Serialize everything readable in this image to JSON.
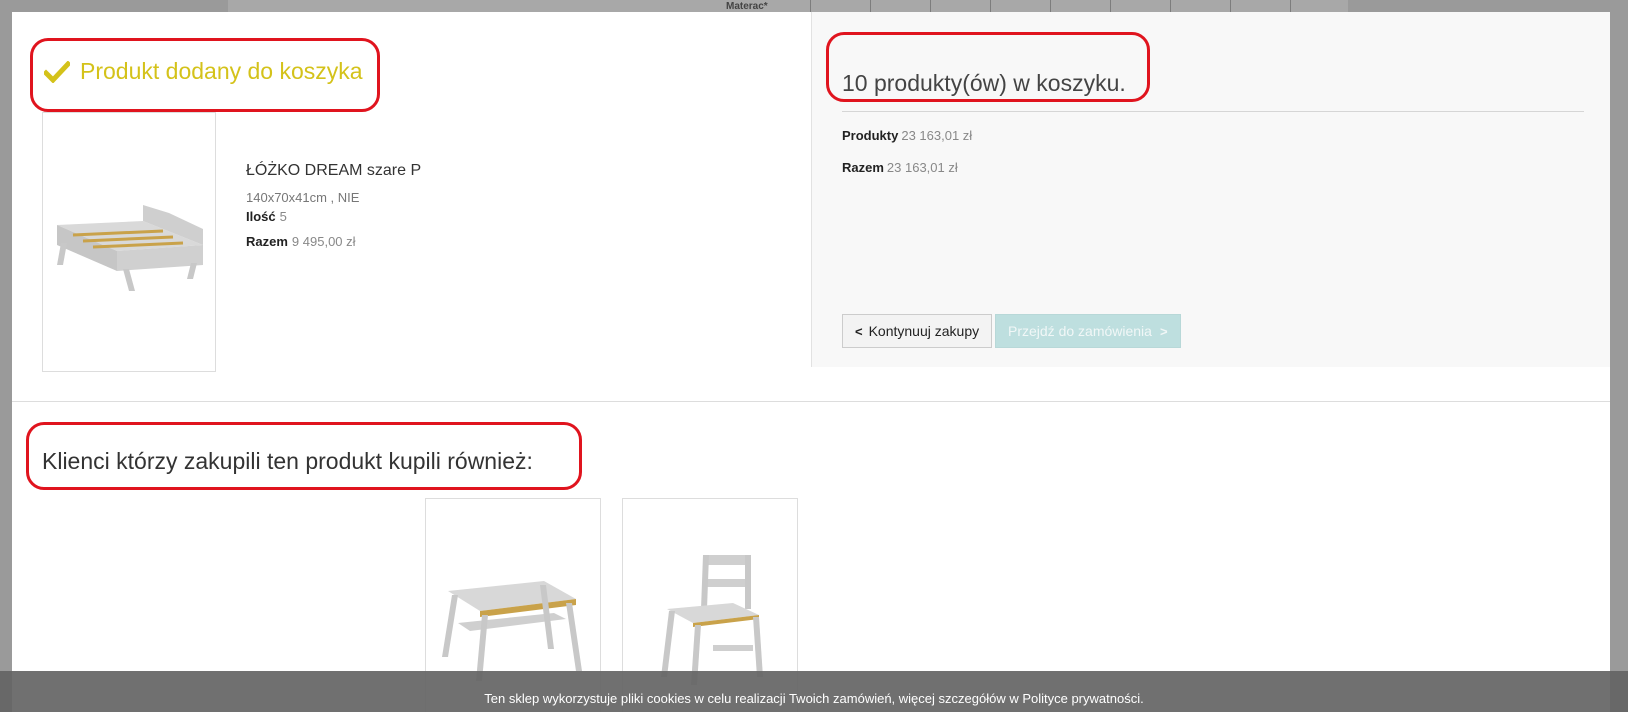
{
  "background": {
    "label": "Materac*"
  },
  "modal": {
    "close_icon": "close-circle-icon",
    "added": {
      "title": "Produkt dodany do koszyka",
      "icon": "check-icon"
    },
    "product": {
      "name": "ŁÓŻKO DREAM szare P",
      "attributes": "140x70x41cm , NIE",
      "quantity_label": "Ilość",
      "quantity_value": "5",
      "total_label": "Razem",
      "total_value": "9 495,00 zł"
    },
    "cart": {
      "count_text": "10 produkty(ów) w koszyku.",
      "products_label": "Produkty",
      "products_value": "23 163,01 zł",
      "total_label": "Razem",
      "total_value": "23 163,01 zł",
      "continue_label": "Kontynuuj zakupy",
      "checkout_label": "Przejdź do zamówienia"
    },
    "related": {
      "title": "Klienci którzy zakupili ten produkt kupili również:"
    }
  },
  "cookie_bar": {
    "text": "Ten sklep wykorzystuje pliki cookies w celu realizacji Twoich zamówień, więcej szczegółów w Polityce prywatności."
  },
  "colors": {
    "accent_yellow": "#d4c21a",
    "highlight_red": "#e0141e",
    "checkout_teal": "#bedfdf"
  }
}
